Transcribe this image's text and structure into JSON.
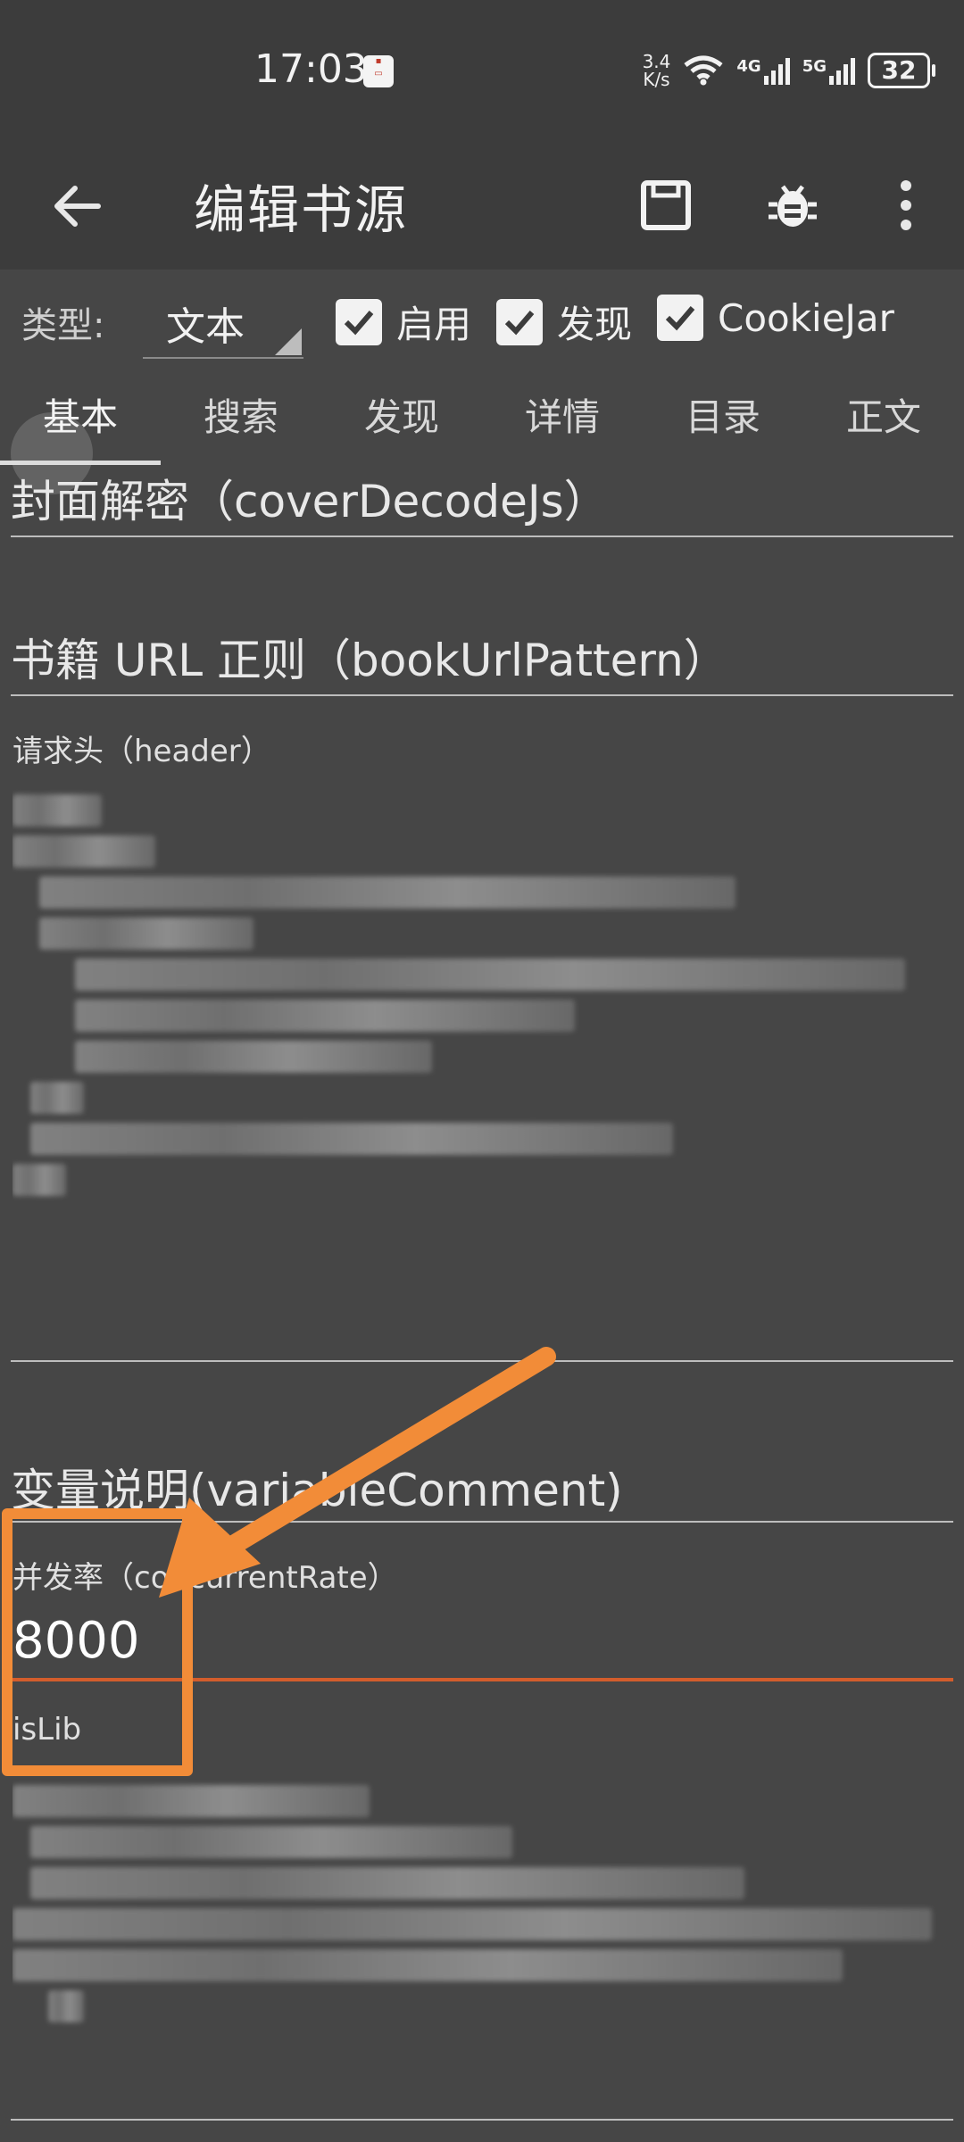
{
  "status_bar": {
    "time": "17:03",
    "notification_icon": "app-notification-icon",
    "net_speed": "3.4\nK/s",
    "network_1": "4G",
    "network_2": "5G",
    "battery": "32"
  },
  "toolbar": {
    "title": "编辑书源",
    "back_icon": "arrow-left-icon",
    "save_icon": "save-icon",
    "debug_icon": "bug-icon",
    "more_icon": "more-vertical-icon"
  },
  "type_bar": {
    "type_label": "类型:",
    "type_value": "文本",
    "checkboxes": [
      {
        "label": "启用",
        "checked": true
      },
      {
        "label": "发现",
        "checked": true
      },
      {
        "label": "CookieJar",
        "checked": true
      }
    ]
  },
  "tabs": [
    {
      "label": "基本",
      "active": true
    },
    {
      "label": "搜索",
      "active": false
    },
    {
      "label": "发现",
      "active": false
    },
    {
      "label": "详情",
      "active": false
    },
    {
      "label": "目录",
      "active": false
    },
    {
      "label": "正文",
      "active": false
    }
  ],
  "form": {
    "cover_decode_hint": "封面解密（coverDecodeJs）",
    "book_url_pattern_hint": "书籍 URL 正则（bookUrlPattern）",
    "header_label": "请求头（header）",
    "variable_comment_hint": "变量说明(variableComment)",
    "concurrent_rate_label": "并发率（concurrentRate）",
    "concurrent_rate_value": "8000",
    "is_lib_label": "isLib"
  },
  "colors": {
    "background": "#464646",
    "toolbar": "#3c3c3c",
    "accent": "#d35d2c",
    "annotation": "#f28c38"
  }
}
